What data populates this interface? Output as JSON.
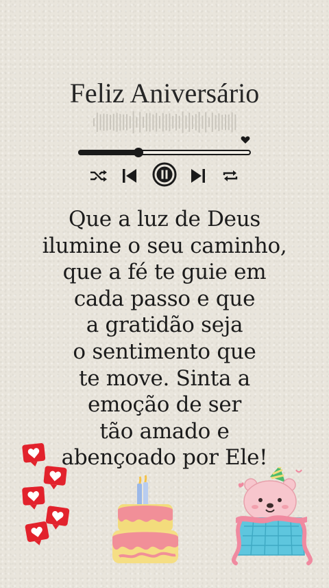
{
  "card": {
    "title": "Feliz Aniversário",
    "message_lines": [
      "Que a luz de Deus",
      "ilumine o seu caminho,",
      "que a fé te guie em",
      "cada passo e que",
      "a gratidão seja",
      "o sentimento que",
      "te move. Sinta a",
      "emoção de ser",
      "tão amado e",
      "abençoado por Ele!"
    ]
  },
  "player": {
    "progress": 0.35,
    "controls": [
      "shuffle-icon",
      "previous-icon",
      "pause-icon",
      "next-icon",
      "repeat-icon"
    ],
    "favorite_icon": "heart-icon"
  },
  "decorations": [
    "heart-notification-icons",
    "birthday-cake-icon",
    "party-bear-gift-icon"
  ],
  "colors": {
    "background": "#e9e5dc",
    "text": "#1b1b1b",
    "heart_red": "#e2222c",
    "cake_pink": "#f18f98",
    "cake_yellow": "#f3dc7c",
    "gift_blue": "#5ec6de",
    "bear_pink": "#f7c6cd",
    "hat_green": "#4dbb6c"
  }
}
